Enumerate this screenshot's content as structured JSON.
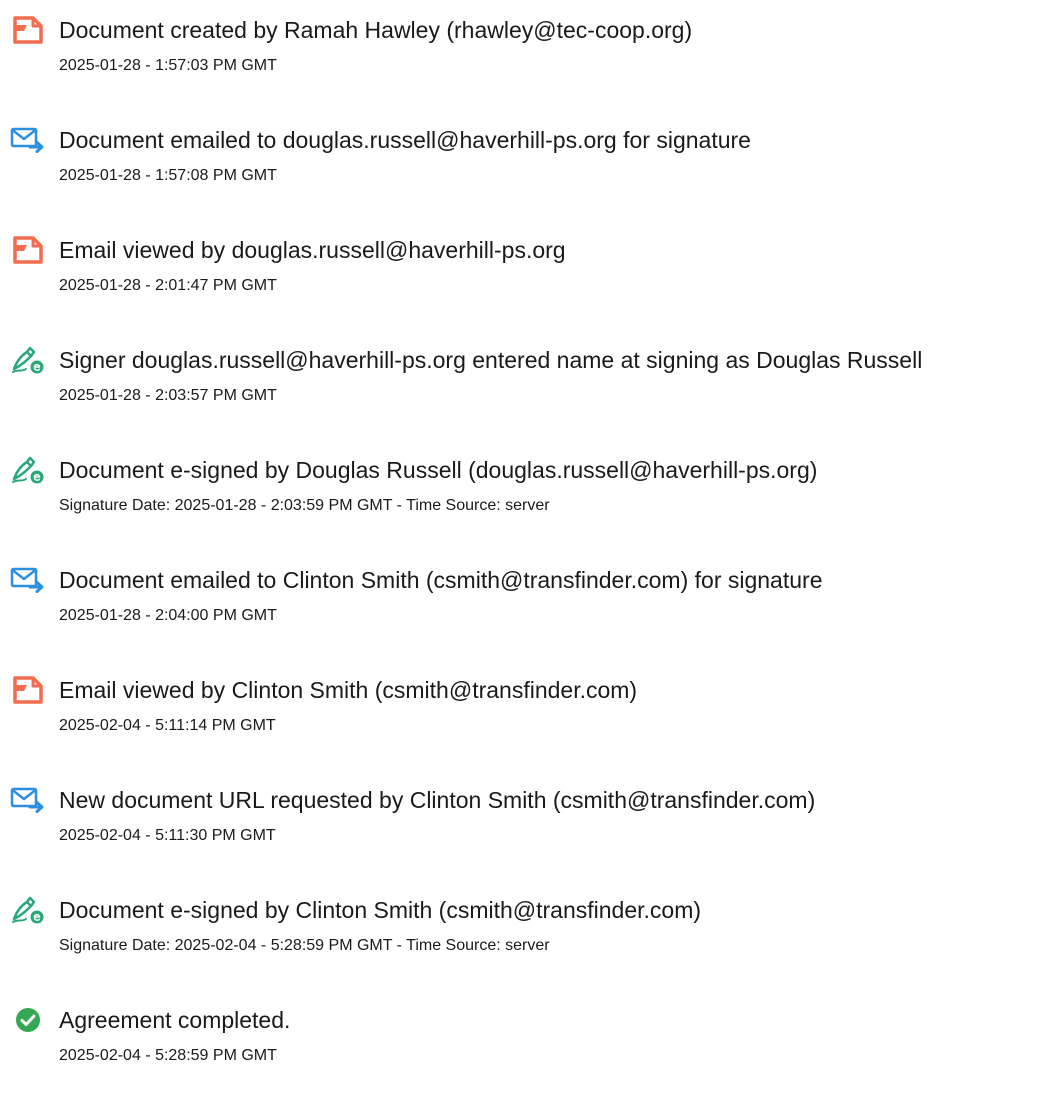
{
  "colors": {
    "document_icon": "#f26c4f",
    "email_icon": "#2c8fe0",
    "sign_icon": "#2aa87a",
    "complete_icon": "#34a853",
    "text": "#1a1a1a"
  },
  "events": [
    {
      "icon": "document-icon",
      "title": "Document created by Ramah Hawley (rhawley@tec-coop.org)",
      "detail": "2025-01-28 - 1:57:03 PM GMT"
    },
    {
      "icon": "email-sent-icon",
      "title": "Document emailed to douglas.russell@haverhill-ps.org for signature",
      "detail": "2025-01-28 - 1:57:08 PM GMT"
    },
    {
      "icon": "document-icon",
      "title": "Email viewed by douglas.russell@haverhill-ps.org",
      "detail": "2025-01-28 - 2:01:47 PM GMT"
    },
    {
      "icon": "e-sign-icon",
      "title": "Signer douglas.russell@haverhill-ps.org entered name at signing as Douglas Russell",
      "detail": "2025-01-28 - 2:03:57 PM GMT"
    },
    {
      "icon": "e-sign-icon",
      "title": "Document e-signed by Douglas Russell (douglas.russell@haverhill-ps.org)",
      "detail": "Signature Date: 2025-01-28 - 2:03:59 PM GMT - Time Source: server"
    },
    {
      "icon": "email-sent-icon",
      "title": "Document emailed to Clinton Smith (csmith@transfinder.com) for signature",
      "detail": "2025-01-28 - 2:04:00 PM GMT"
    },
    {
      "icon": "document-icon",
      "title": "Email viewed by Clinton Smith (csmith@transfinder.com)",
      "detail": "2025-02-04 - 5:11:14 PM GMT"
    },
    {
      "icon": "email-sent-icon",
      "title": "New document URL requested by Clinton Smith (csmith@transfinder.com)",
      "detail": "2025-02-04 - 5:11:30 PM GMT"
    },
    {
      "icon": "e-sign-icon",
      "title": "Document e-signed by Clinton Smith (csmith@transfinder.com)",
      "detail": "Signature Date: 2025-02-04 - 5:28:59 PM GMT - Time Source: server"
    },
    {
      "icon": "check-circle-icon",
      "title": "Agreement completed.",
      "detail": "2025-02-04 - 5:28:59 PM GMT"
    }
  ]
}
